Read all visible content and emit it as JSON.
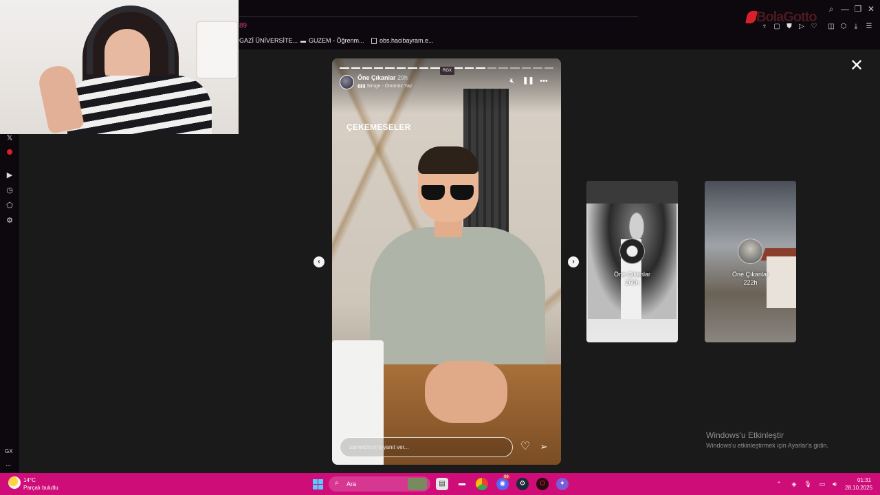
{
  "browser": {
    "tab_count": "89",
    "bookmarks": [
      "GAZİ ÜNİVERSİTE...",
      "GUZEM - Öğrenm...",
      "obs.hacibayram.e..."
    ],
    "logo_text": "Bola Gotto",
    "window_controls": [
      "search-icon",
      "minimize-icon",
      "restore-icon",
      "menu-icon"
    ],
    "toolbar_icons": [
      "extensions-icon",
      "snapshot-icon",
      "vpn-icon",
      "play-icon",
      "heart-icon",
      "wallet-icon",
      "download-icon",
      "sidebar-icon"
    ]
  },
  "sidebar": {
    "icons": [
      "x-icon",
      "opera-icon",
      "player-icon",
      "history-icon",
      "extensions-icon",
      "settings-icon"
    ],
    "gx_label": "GX",
    "more": "..."
  },
  "story": {
    "author": "Öne Çıkanlar",
    "time": "29h",
    "music": "Simge - Önümüz Yaz",
    "badge": "RGX",
    "caption": "ÇEKEMESELER",
    "reply_placeholder": "sametdrccn'e yanıt ver...",
    "segments_total": 19,
    "segments_done": 13
  },
  "previews": [
    {
      "title": "Öne Çıkanlar",
      "time": "260h"
    },
    {
      "title": "Öne Çıkanlar",
      "time": "222h"
    }
  ],
  "watermark": {
    "title": "Windows'u Etkinleştir",
    "subtitle": "Windows'u etkinleştirmek için Ayarlar'a gidin."
  },
  "taskbar": {
    "temperature": "14°C",
    "weather": "Parçalı bulutlu",
    "search_label": "Ara",
    "discord_badge": "99",
    "time": "01:31",
    "date": "28.10.2025"
  },
  "colors": {
    "taskbar": "#ce0d79",
    "accent_red": "#d8202a",
    "page_bg": "#1a1a1a"
  }
}
